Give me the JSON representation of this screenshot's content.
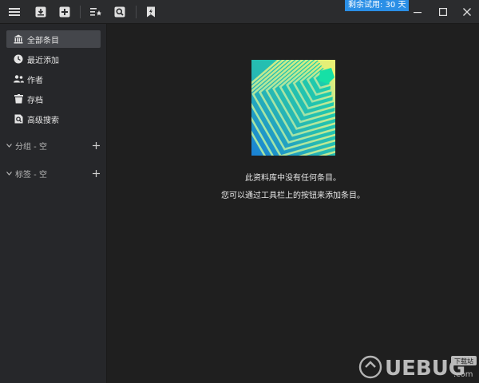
{
  "trial": {
    "badge": "剩余试用: 30 天"
  },
  "toolbar": {
    "icons": [
      "menu-icon",
      "import-icon",
      "add-icon",
      "reading-list-icon",
      "search-icon",
      "bookmark-icon"
    ]
  },
  "sidebar": {
    "items": [
      {
        "label": "全部条目",
        "icon": "library-icon",
        "active": true
      },
      {
        "label": "最近添加",
        "icon": "clock-icon",
        "active": false
      },
      {
        "label": "作者",
        "icon": "people-icon",
        "active": false
      },
      {
        "label": "存档",
        "icon": "archive-icon",
        "active": false
      },
      {
        "label": "高级搜索",
        "icon": "advanced-search-icon",
        "active": false
      }
    ],
    "groups": [
      {
        "label": "分组 - 空"
      },
      {
        "label": "标签 - 空"
      }
    ]
  },
  "main": {
    "empty_line1": "此资料库中没有任何条目。",
    "empty_line2": "您可以通过工具栏上的按钮来添加条目。"
  },
  "watermark": {
    "brand": "UEBUG",
    "tag": "下载站",
    "domain": ".com"
  },
  "colors": {
    "accent": "#2a8fe6",
    "sidebar_bg": "#26272a",
    "main_bg": "#1f1f1f",
    "active_item": "#44464b"
  }
}
